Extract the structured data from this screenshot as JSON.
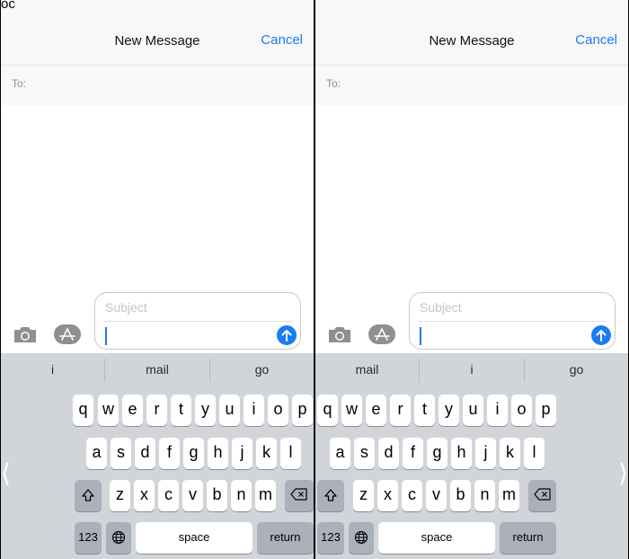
{
  "status": {
    "carrier_fragment": "oc"
  },
  "panels": [
    {
      "nav": {
        "title": "New Message",
        "cancel": "Cancel"
      },
      "to_label": "To:",
      "compose": {
        "subject_placeholder": "Subject"
      },
      "suggestions": [
        "i",
        "mail",
        "go"
      ],
      "keyboard": {
        "row1": [
          "q",
          "w",
          "e",
          "r",
          "t",
          "y",
          "u",
          "i",
          "o",
          "p"
        ],
        "row2": [
          "a",
          "s",
          "d",
          "f",
          "g",
          "h",
          "j",
          "k",
          "l"
        ],
        "row3": [
          "z",
          "x",
          "c",
          "v",
          "b",
          "n",
          "m"
        ],
        "numbers": "123",
        "space": "space",
        "return": "return"
      }
    },
    {
      "nav": {
        "title": "New Message",
        "cancel": "Cancel"
      },
      "to_label": "To:",
      "compose": {
        "subject_placeholder": "Subject"
      },
      "suggestions": [
        "mail",
        "i",
        "go"
      ],
      "keyboard": {
        "row1": [
          "q",
          "w",
          "e",
          "r",
          "t",
          "y",
          "u",
          "i",
          "o",
          "p"
        ],
        "row2": [
          "a",
          "s",
          "d",
          "f",
          "g",
          "h",
          "j",
          "k",
          "l"
        ],
        "row3": [
          "z",
          "x",
          "c",
          "v",
          "b",
          "n",
          "m"
        ],
        "numbers": "123",
        "space": "space",
        "return": "return"
      }
    }
  ],
  "chevrons": {
    "left": "⟨",
    "right": "⟩"
  },
  "colors": {
    "accent": "#1a7cf3",
    "keyboard_bg": "#d1d4d9",
    "dark_key": "#abb1ba"
  }
}
